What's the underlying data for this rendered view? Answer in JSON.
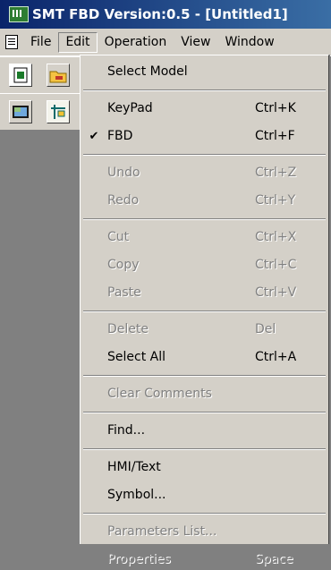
{
  "window": {
    "title": "SMT FBD Version:0.5 - [Untitled1]"
  },
  "menubar": {
    "items": [
      "File",
      "Edit",
      "Operation",
      "View",
      "Window"
    ]
  },
  "edit_menu": [
    {
      "label": "Select Model",
      "shortcut": "",
      "enabled": true,
      "checked": false
    },
    {
      "separator": true
    },
    {
      "label": "KeyPad",
      "shortcut": "Ctrl+K",
      "enabled": true,
      "checked": false
    },
    {
      "label": "FBD",
      "shortcut": "Ctrl+F",
      "enabled": true,
      "checked": true
    },
    {
      "separator": true
    },
    {
      "label": "Undo",
      "shortcut": "Ctrl+Z",
      "enabled": false,
      "checked": false
    },
    {
      "label": "Redo",
      "shortcut": "Ctrl+Y",
      "enabled": false,
      "checked": false
    },
    {
      "separator": true
    },
    {
      "label": "Cut",
      "shortcut": "Ctrl+X",
      "enabled": false,
      "checked": false
    },
    {
      "label": "Copy",
      "shortcut": "Ctrl+C",
      "enabled": false,
      "checked": false
    },
    {
      "label": "Paste",
      "shortcut": "Ctrl+V",
      "enabled": false,
      "checked": false
    },
    {
      "separator": true
    },
    {
      "label": "Delete",
      "shortcut": "Del",
      "enabled": false,
      "checked": false
    },
    {
      "label": "Select All",
      "shortcut": "Ctrl+A",
      "enabled": true,
      "checked": false
    },
    {
      "separator": true
    },
    {
      "label": "Clear Comments",
      "shortcut": "",
      "enabled": false,
      "checked": false
    },
    {
      "separator": true
    },
    {
      "label": "Find...",
      "shortcut": "",
      "enabled": true,
      "checked": false
    },
    {
      "separator": true
    },
    {
      "label": "HMI/Text",
      "shortcut": "",
      "enabled": true,
      "checked": false
    },
    {
      "label": "Symbol...",
      "shortcut": "",
      "enabled": true,
      "checked": false
    },
    {
      "separator": true
    },
    {
      "label": "Parameters List...",
      "shortcut": "",
      "enabled": false,
      "checked": false
    },
    {
      "label": "Properties",
      "shortcut": "Space",
      "enabled": false,
      "checked": false
    }
  ],
  "icons": {
    "check": "✔",
    "toolbar": [
      "new-icon",
      "open-icon",
      "view-icon",
      "fbd-icon"
    ]
  }
}
